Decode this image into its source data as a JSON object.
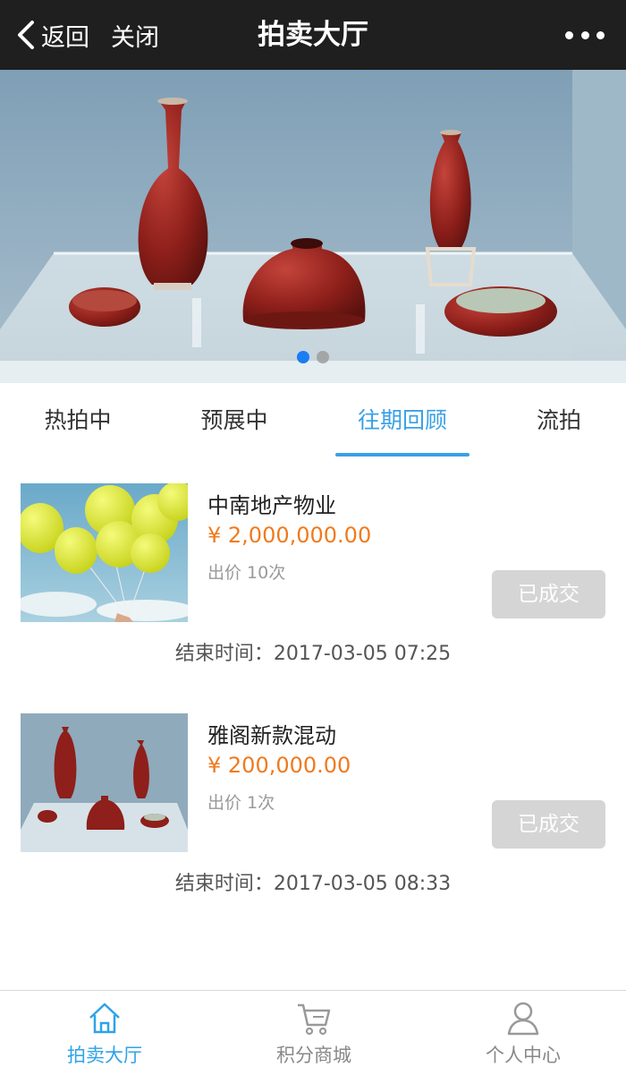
{
  "nav": {
    "back_label": "返回",
    "close_label": "关闭",
    "title": "拍卖大厅"
  },
  "banner": {
    "slide_count": 2,
    "active_slide": 1
  },
  "tabs": [
    {
      "label": "热拍中",
      "active": false
    },
    {
      "label": "预展中",
      "active": false
    },
    {
      "label": "往期回顾",
      "active": true
    },
    {
      "label": "流拍",
      "active": false
    }
  ],
  "items": [
    {
      "name": "中南地产物业",
      "price": "¥ 2,000,000.00",
      "bids": "出价 10次",
      "status": "已成交",
      "end_time": "结束时间：2017-03-05 07:25",
      "thumb": "balloons-photo"
    },
    {
      "name": "雅阁新款混动",
      "price": "¥ 200,000.00",
      "bids": "出价 1次",
      "status": "已成交",
      "end_time": "结束时间：2017-03-05 08:33",
      "thumb": "vases-photo"
    }
  ],
  "bottom_nav": [
    {
      "label": "拍卖大厅",
      "icon": "home-icon",
      "active": true
    },
    {
      "label": "积分商城",
      "icon": "cart-icon",
      "active": false
    },
    {
      "label": "个人中心",
      "icon": "user-icon",
      "active": false
    }
  ],
  "colors": {
    "accent": "#3aa0e6",
    "price": "#f07a1e",
    "topbar": "#1f1f1f",
    "deal_button": "#d5d5d5"
  }
}
